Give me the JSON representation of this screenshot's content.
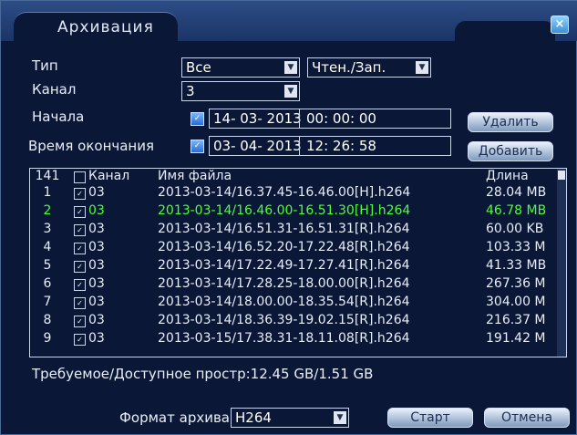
{
  "window": {
    "title": "Архивация"
  },
  "form": {
    "type_label": "Тип",
    "type_value": "Все",
    "mode_value": "Чтен./Зап.",
    "channel_label": "Канал",
    "channel_value": "3",
    "start_label": "Начала",
    "start_date": "14- 03- 2013",
    "start_time": "00: 00: 00",
    "end_label": "Время окончания",
    "end_date": "03- 04- 2013",
    "end_time": "12: 26: 58",
    "delete_button": "Удалить",
    "add_button": "Добавить"
  },
  "list": {
    "header": {
      "count": "141",
      "channel": "Канал",
      "filename": "Имя файла",
      "length": "Длина"
    },
    "rows": [
      {
        "num": "1",
        "channel": "03",
        "file": "2013-03-14/16.37.45-16.46.00[H].h264",
        "length": "28.04 MB",
        "highlight": false
      },
      {
        "num": "2",
        "channel": "03",
        "file": "2013-03-14/16.46.00-16.51.30[H].h264",
        "length": "46.78 MB",
        "highlight": true
      },
      {
        "num": "3",
        "channel": "03",
        "file": "2013-03-14/16.51.31-16.51.31[R].h264",
        "length": "60.00 KB",
        "highlight": false
      },
      {
        "num": "4",
        "channel": "03",
        "file": "2013-03-14/16.52.20-17.22.48[R].h264",
        "length": "103.33 M",
        "highlight": false
      },
      {
        "num": "5",
        "channel": "03",
        "file": "2013-03-14/17.22.49-17.27.41[R].h264",
        "length": "41.33 MB",
        "highlight": false
      },
      {
        "num": "6",
        "channel": "03",
        "file": "2013-03-14/17.28.25-18.00.00[R].h264",
        "length": "267.36 M",
        "highlight": false
      },
      {
        "num": "7",
        "channel": "03",
        "file": "2013-03-14/18.00.00-18.35.54[R].h264",
        "length": "304.00 M",
        "highlight": false
      },
      {
        "num": "8",
        "channel": "03",
        "file": "2013-03-14/18.36.39-19.02.15[R].h264",
        "length": "216.37 M",
        "highlight": false
      },
      {
        "num": "9",
        "channel": "03",
        "file": "2013-03-15/17.38.31-18.11.08[R].h264",
        "length": "191.42 M",
        "highlight": false
      }
    ]
  },
  "storage_text": "Требуемое/Доступное простр:12.45 GB/1.51 GB",
  "footer": {
    "format_label": "Формат архива",
    "format_value": "H264",
    "start_button": "Старт",
    "cancel_button": "Отмена"
  }
}
